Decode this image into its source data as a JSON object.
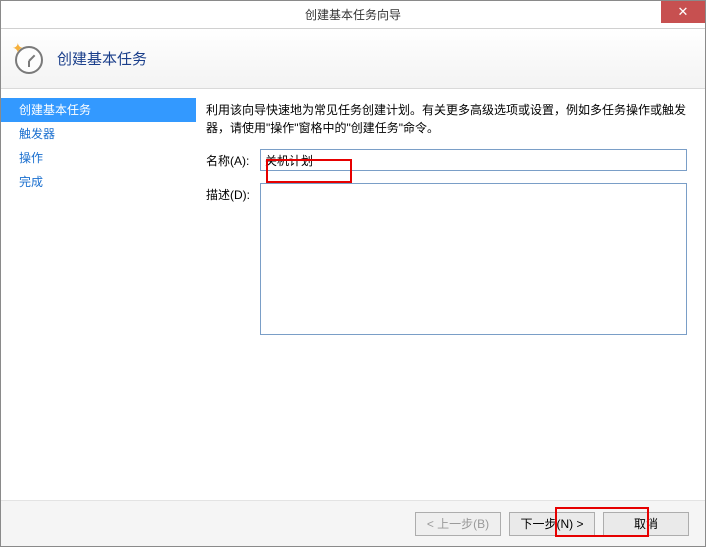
{
  "window": {
    "title": "创建基本任务向导"
  },
  "header": {
    "title": "创建基本任务"
  },
  "sidebar": {
    "items": [
      {
        "label": "创建基本任务",
        "active": true
      },
      {
        "label": "触发器",
        "active": false
      },
      {
        "label": "操作",
        "active": false
      },
      {
        "label": "完成",
        "active": false
      }
    ]
  },
  "content": {
    "intro": "利用该向导快速地为常见任务创建计划。有关更多高级选项或设置，例如多任务操作或触发器，请使用\"操作\"窗格中的\"创建任务\"命令。",
    "name_label": "名称(A):",
    "name_value": "关机计划",
    "desc_label": "描述(D):",
    "desc_value": ""
  },
  "footer": {
    "back": "< 上一步(B)",
    "next": "下一步(N) >",
    "cancel": "取消"
  }
}
